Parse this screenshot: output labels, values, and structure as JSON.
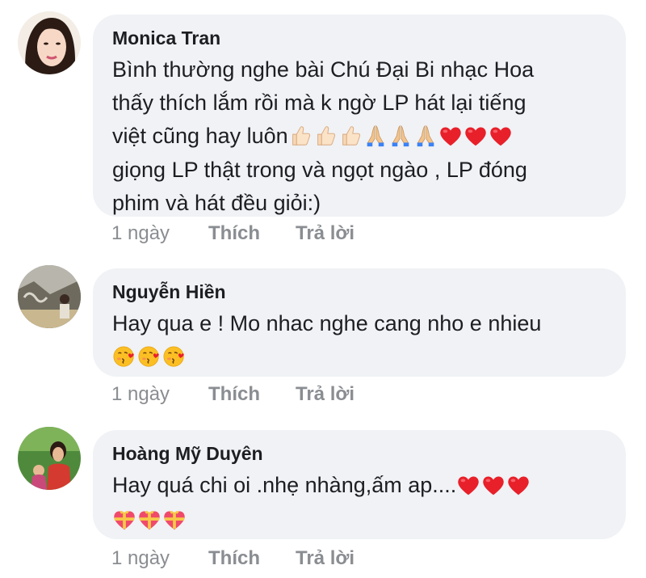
{
  "comments": [
    {
      "author": "Monica Tran",
      "text_lines": [
        "Bình thường nghe bài Chú Đại Bi nhạc Hoa",
        "thấy thích lắm rồi mà k ngờ LP hát lại tiếng",
        "việt cũng hay luôn",
        "giọng LP thật trong và ngọt ngào , LP đóng",
        "phim và hát đều giỏi:)"
      ],
      "emojis": [
        "thumbs-up-icon",
        "thumbs-up-icon",
        "thumbs-up-icon",
        "folded-hands-icon",
        "folded-hands-icon",
        "folded-hands-icon",
        "red-heart-icon",
        "red-heart-icon",
        "red-heart-icon"
      ],
      "time": "1 ngày",
      "like_label": "Thích",
      "reply_label": "Trả lời"
    },
    {
      "author": "Nguyễn Hiền",
      "text_lines": [
        "Hay qua e ! Mo nhac nghe cang nho e nhieu"
      ],
      "emojis": [
        "kissing-heart-face-icon",
        "kissing-heart-face-icon",
        "kissing-heart-face-icon"
      ],
      "time": "1 ngày",
      "like_label": "Thích",
      "reply_label": "Trả lời"
    },
    {
      "author": "Hoàng Mỹ Duyên",
      "text_lines": [
        "Hay quá chi oi .nhẹ nhàng,ấm ap...."
      ],
      "emojis": [
        "red-heart-icon",
        "red-heart-icon",
        "red-heart-icon",
        "heart-gift-icon",
        "heart-gift-icon",
        "heart-gift-icon"
      ],
      "time": "1 ngày",
      "like_label": "Thích",
      "reply_label": "Trả lời"
    }
  ],
  "colors": {
    "bubble": "#f0f2f5",
    "author_text": "#1c1e21",
    "meta_text": "#8a8d91"
  }
}
